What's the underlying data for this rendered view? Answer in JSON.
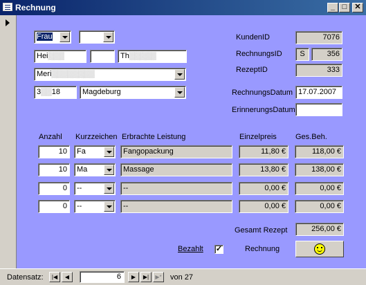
{
  "window": {
    "title": "Rechnung",
    "buttons": {
      "minimize": "_",
      "maximize": "□",
      "close": "✕"
    }
  },
  "customer": {
    "anrede": "Frau",
    "titel": "",
    "vorname": "Hei",
    "vorname_masked": "▒▒▒",
    "zwischen": "",
    "nachname": "Th",
    "nachname_masked": "▒▒▒▒▒",
    "strasse": "Meri",
    "strasse_masked": "▒▒▒▒▒▒▒▒",
    "plz": "3",
    "plz_masked": "▒▒",
    "plz_end": "18",
    "ort": "Magdeburg"
  },
  "meta": {
    "kunden_label": "KundenID",
    "kunden_value": "7076",
    "rechnungs_label": "RechnungsID",
    "rechnungs_prefix": "S",
    "rechnungs_value": "356",
    "rezept_label": "RezeptID",
    "rezept_value": "333",
    "datum_label": "RechnungsDatum",
    "datum_value": "17.07.2007",
    "erinnerung_label": "ErinnerungsDatum",
    "erinnerung_value": ""
  },
  "columns": {
    "anzahl": "Anzahl",
    "kurz": "Kurzzeichen",
    "leistung": "Erbrachte Leistung",
    "einzel": "Einzelpreis",
    "gesamt": "Ges.Beh."
  },
  "rows": [
    {
      "anzahl": "10",
      "kurz": "Fa",
      "leistung": "Fangopackung",
      "einzel": "11,80 €",
      "gesamt": "118,00 €"
    },
    {
      "anzahl": "10",
      "kurz": "Ma",
      "leistung": "Massage",
      "einzel": "13,80 €",
      "gesamt": "138,00 €"
    },
    {
      "anzahl": "0",
      "kurz": "--",
      "leistung": "--",
      "einzel": "0,00 €",
      "gesamt": "0,00 €"
    },
    {
      "anzahl": "0",
      "kurz": "--",
      "leistung": "--",
      "einzel": "0,00 €",
      "gesamt": "0,00 €"
    }
  ],
  "summary": {
    "gesamt_label": "Gesamt Rezept",
    "gesamt_value": "256,00 €",
    "bezahlt_label": "Bezahlt",
    "bezahlt_checked": "✓",
    "rechnung_label": "Rechnung"
  },
  "nav": {
    "label": "Datensatz:",
    "first": "|◀",
    "prev": "◀",
    "current": "6",
    "next": "▶",
    "last": "▶|",
    "new": "▶*",
    "of_text": "von 27"
  }
}
